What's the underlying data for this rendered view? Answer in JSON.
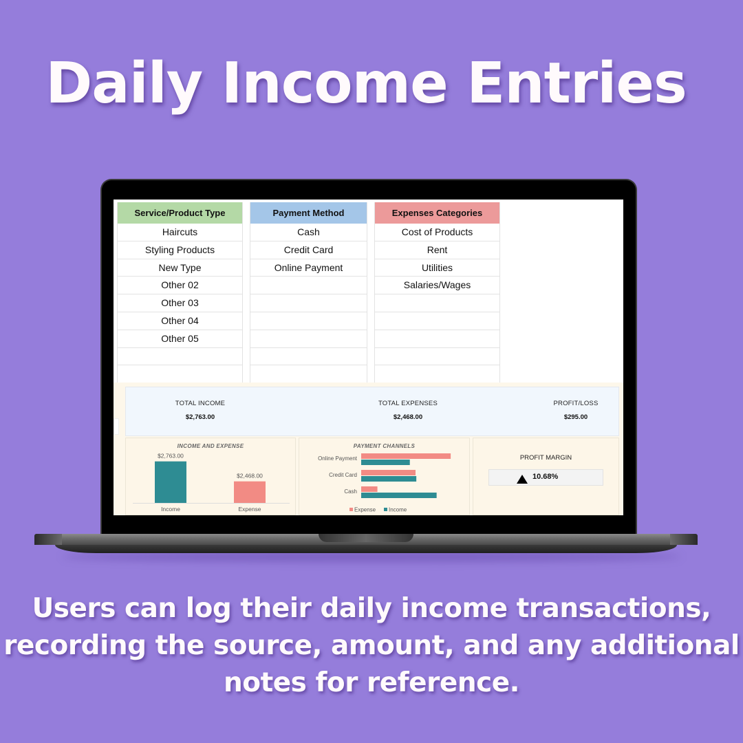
{
  "headline": "Daily Income Entries",
  "caption": "Users can log their daily income transactions, recording the source, amount, and any additional notes for reference.",
  "colors": {
    "background": "#957ddb",
    "income": "#2e8c93",
    "expense": "#f28b84",
    "service_header": "#b4d9a6",
    "payment_header": "#a4c6e8",
    "expenses_header": "#ec9a9a"
  },
  "lists": {
    "service_product_type": {
      "header": "Service/Product Type",
      "items": [
        "Haircuts",
        "Styling Products",
        "New Type",
        "Other 02",
        "Other 03",
        "Other 04",
        "Other 05",
        "",
        ""
      ]
    },
    "payment_method": {
      "header": "Payment Method",
      "items": [
        "Cash",
        "Credit Card",
        "Online Payment",
        "",
        "",
        "",
        "",
        "",
        ""
      ]
    },
    "expenses_categories": {
      "header": "Expenses Categories",
      "items": [
        "Cost of Products",
        "Rent",
        "Utilities",
        "Salaries/Wages",
        "",
        "",
        "",
        "",
        ""
      ]
    }
  },
  "summary": {
    "total_income": {
      "label": "TOTAL INCOME",
      "value": "$2,763.00"
    },
    "total_expenses": {
      "label": "TOTAL EXPENSES",
      "value": "$2,468.00"
    },
    "profit_loss": {
      "label": "PROFIT/LOSS",
      "value": "$295.00"
    }
  },
  "profit_margin": {
    "label": "PROFIT MARGIN",
    "value": "10.68%",
    "trend": "up"
  },
  "chart_data": [
    {
      "type": "bar",
      "title": "INCOME AND EXPENSE",
      "categories": [
        "Income",
        "Expense"
      ],
      "values": [
        2763,
        2468
      ],
      "data_labels": [
        "$2,763.00",
        "$2,468.00"
      ],
      "colors": [
        "#2e8c93",
        "#f28b84"
      ],
      "ylim": [
        2150,
        2800
      ],
      "grid": false,
      "legend": "none"
    },
    {
      "type": "bar",
      "orientation": "horizontal",
      "title": "PAYMENT CHANNELS",
      "categories": [
        "Online Payment",
        "Credit Card",
        "Cash"
      ],
      "series": [
        {
          "name": "Expense",
          "values": [
            1380,
            838,
            250
          ],
          "color": "#f28b84"
        },
        {
          "name": "Income",
          "values": [
            750,
            850,
            1163
          ],
          "color": "#2e8c93"
        }
      ],
      "xlim": [
        0,
        1400
      ],
      "grid": false,
      "legend": "bottom"
    }
  ]
}
